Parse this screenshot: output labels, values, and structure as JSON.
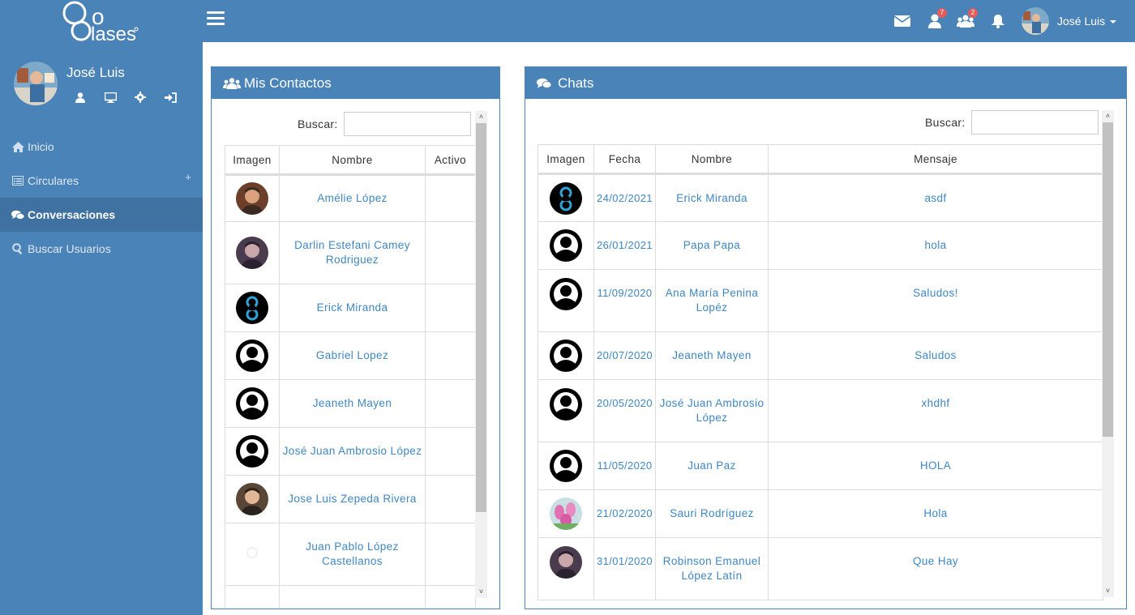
{
  "sidebar": {
    "logo_text": "Go Clases",
    "user_name": "José Luis",
    "menu": [
      {
        "label": "Inicio",
        "icon": "home-icon"
      },
      {
        "label": "Circulares",
        "icon": "list-icon",
        "expand": "+"
      },
      {
        "label": "Conversaciones",
        "icon": "comments-icon"
      },
      {
        "label": "Buscar Usuarios",
        "icon": "search-icon"
      }
    ]
  },
  "topbar": {
    "friend_requests_count": "7",
    "groups_count": "2",
    "user_name": "José Luis"
  },
  "contacts": {
    "title": "Mis Contactos",
    "search_label": "Buscar:",
    "columns": [
      "Imagen",
      "Nombre",
      "Activo"
    ],
    "rows": [
      {
        "name": "Amélie López",
        "avatar": "photo"
      },
      {
        "name": "Darlin Estefani Camey Rodriguez",
        "avatar": "photo"
      },
      {
        "name": "Erick Miranda",
        "avatar": "logo"
      },
      {
        "name": "Gabriel Lopez",
        "avatar": "default"
      },
      {
        "name": "Jeaneth Mayen",
        "avatar": "default"
      },
      {
        "name": "José Juan Ambrosio López",
        "avatar": "default"
      },
      {
        "name": "Jose Luis Zepeda Rivera",
        "avatar": "photo"
      },
      {
        "name": "Juan Pablo López Castellanos",
        "avatar": "blank"
      }
    ]
  },
  "chats": {
    "title": "Chats",
    "search_label": "Buscar:",
    "columns": [
      "Imagen",
      "Fecha",
      "Nombre",
      "Mensaje"
    ],
    "rows": [
      {
        "date": "24/02/2021",
        "name": "Erick Miranda",
        "message": "asdf",
        "avatar": "logo"
      },
      {
        "date": "26/01/2021",
        "name": "Papa Papa",
        "message": "hola",
        "avatar": "default"
      },
      {
        "date": "11/09/2020",
        "name": "Ana María Penina Lopéz",
        "message": "Saludos!",
        "avatar": "default"
      },
      {
        "date": "20/07/2020",
        "name": "Jeaneth Mayen",
        "message": "Saludos",
        "avatar": "default"
      },
      {
        "date": "20/05/2020",
        "name": "José Juan Ambrosio López",
        "message": "xhdhf",
        "avatar": "default"
      },
      {
        "date": "11/05/2020",
        "name": "Juan Paz",
        "message": "HOLA",
        "avatar": "default"
      },
      {
        "date": "21/02/2020",
        "name": "Sauri Rodríguez",
        "message": "Hola",
        "avatar": "flowers"
      },
      {
        "date": "31/01/2020",
        "name": "Robinson Emanuel López Latín",
        "message": "Que Hay",
        "avatar": "photo"
      }
    ]
  },
  "colors": {
    "primary": "#4a83b8",
    "active_menu": "#3f71a1",
    "link": "#3f87c3",
    "badge": "#e25c5c"
  }
}
